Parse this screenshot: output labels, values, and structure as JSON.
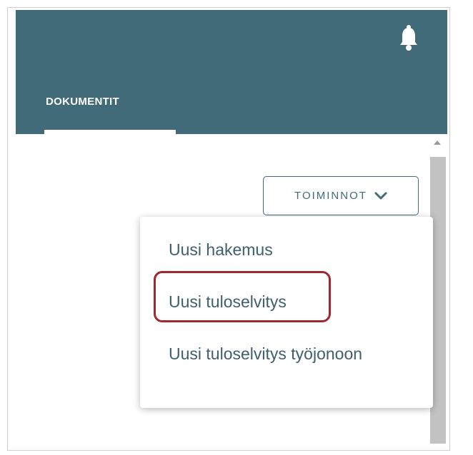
{
  "header": {
    "tab_label": "DOKUMENTIT",
    "bell_icon": "bell-icon",
    "background_color": "#416b79"
  },
  "toolbar": {
    "actions_label": "TOIMINNOT",
    "actions_icon": "chevron-down-icon"
  },
  "menu": {
    "items": [
      {
        "label": "Uusi hakemus"
      },
      {
        "label": "Uusi tuloselvitys",
        "highlighted": true
      },
      {
        "label": "Uusi tuloselvitys työjonoon"
      }
    ],
    "highlight_color": "#a0272d"
  }
}
